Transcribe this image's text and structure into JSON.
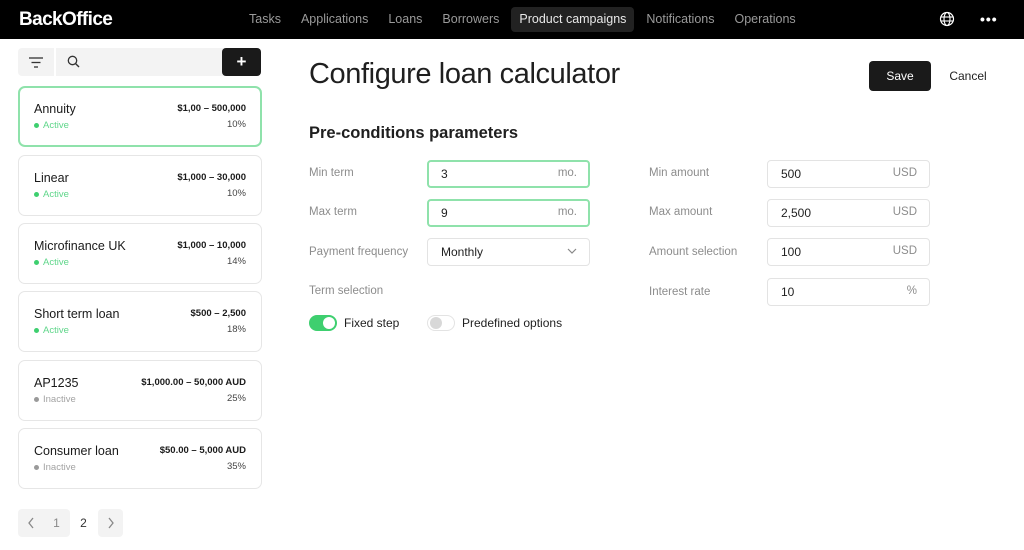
{
  "app": {
    "title": "BackOffice"
  },
  "nav": {
    "items": [
      {
        "label": "Tasks",
        "active": false
      },
      {
        "label": "Applications",
        "active": false
      },
      {
        "label": "Loans",
        "active": false
      },
      {
        "label": "Borrowers",
        "active": false
      },
      {
        "label": "Product campaigns",
        "active": true
      },
      {
        "label": "Notifications",
        "active": false
      },
      {
        "label": "Operations",
        "active": false
      }
    ],
    "icons": {
      "language": "globe-icon",
      "more": "more-icon"
    },
    "more_glyph": "•••"
  },
  "sidebar": {
    "search": {
      "placeholder": "",
      "value": ""
    },
    "add_label": "+",
    "products": [
      {
        "name": "Annuity",
        "range": "$1,00 – 500,000",
        "status": "Active",
        "rate": "10%",
        "selected": true
      },
      {
        "name": "Linear",
        "range": "$1,000 – 30,000",
        "status": "Active",
        "rate": "10%",
        "selected": false
      },
      {
        "name": "Microfinance UK",
        "range": "$1,000 – 10,000",
        "status": "Active",
        "rate": "14%",
        "selected": false
      },
      {
        "name": "Short term loan",
        "range": "$500 – 2,500",
        "status": "Active",
        "rate": "18%",
        "selected": false
      },
      {
        "name": "AP1235",
        "range": "$1,000.00 – 50,000 AUD",
        "status": "Inactive",
        "rate": "25%",
        "selected": false
      },
      {
        "name": "Consumer loan",
        "range": "$50.00 – 5,000 AUD",
        "status": "Inactive",
        "rate": "35%",
        "selected": false
      }
    ],
    "pagination": {
      "prev": "‹",
      "pages": [
        "1",
        "2"
      ],
      "current": "2",
      "next": "›"
    }
  },
  "main": {
    "title": "Configure loan calculator",
    "save_label": "Save",
    "cancel_label": "Cancel",
    "section_title": "Pre-conditions parameters",
    "left_fields": {
      "min_term": {
        "label": "Min term",
        "value": "3",
        "unit": "mo."
      },
      "max_term": {
        "label": "Max term",
        "value": "9",
        "unit": "mo."
      },
      "payment_frequency": {
        "label": "Payment frequency",
        "value": "Monthly"
      },
      "term_selection": {
        "label": "Term selection"
      }
    },
    "toggles": [
      {
        "label": "Fixed step",
        "on": true
      },
      {
        "label": "Predefined options",
        "on": false
      }
    ],
    "right_fields": {
      "min_amount": {
        "label": "Min amount",
        "value": "500",
        "unit": "USD"
      },
      "max_amount": {
        "label": "Max amount",
        "value": "2,500",
        "unit": "USD"
      },
      "amount_selection": {
        "label": "Amount selection",
        "value": "100",
        "unit": "USD"
      },
      "interest_rate": {
        "label": "Interest rate",
        "value": "10",
        "unit": "%"
      }
    }
  },
  "colors": {
    "accent_green": "#3ecf6f",
    "focus_border": "#8fe2ab",
    "topbar": "#000000",
    "primary_button": "#1a1a1a"
  }
}
